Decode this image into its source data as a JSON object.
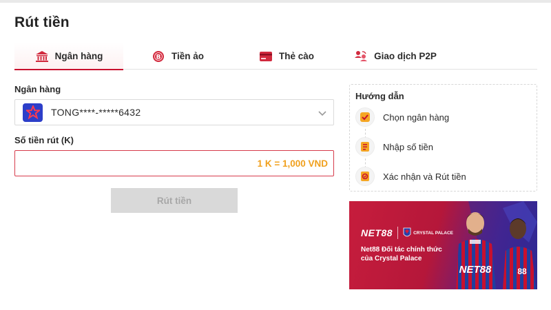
{
  "page": {
    "title": "Rút tiền"
  },
  "tabs": [
    {
      "label": "Ngân hàng",
      "icon": "bank-icon",
      "active": true
    },
    {
      "label": "Tiền ảo",
      "icon": "crypto-coin-icon",
      "active": false
    },
    {
      "label": "Thẻ cào",
      "icon": "card-icon",
      "active": false
    },
    {
      "label": "Giao dịch P2P",
      "icon": "p2p-users-icon",
      "active": false
    }
  ],
  "form": {
    "bank_label": "Ngân hàng",
    "bank_value": "TONG****-*****6432",
    "amount_label": "Số tiền rút (K)",
    "amount_value": "",
    "rate_text": "1 K = 1,000 VND",
    "submit_label": "Rút tiền"
  },
  "guide": {
    "title": "Hướng dẫn",
    "steps": [
      {
        "label": "Chọn ngân hàng",
        "icon": "check-icon"
      },
      {
        "label": "Nhập số tiền",
        "icon": "form-icon"
      },
      {
        "label": "Xác nhận và Rút tiền",
        "icon": "confirm-icon"
      }
    ]
  },
  "banner": {
    "brand": "NET88",
    "partner": "CRYSTAL PALACE",
    "tagline": "Net88 Đối tác chính thức của Crystal Palace",
    "jersey_text": "NET88"
  },
  "colors": {
    "accent": "#c8102e",
    "rate": "#f0a01e",
    "disabled_button": "#d9d9d9"
  }
}
